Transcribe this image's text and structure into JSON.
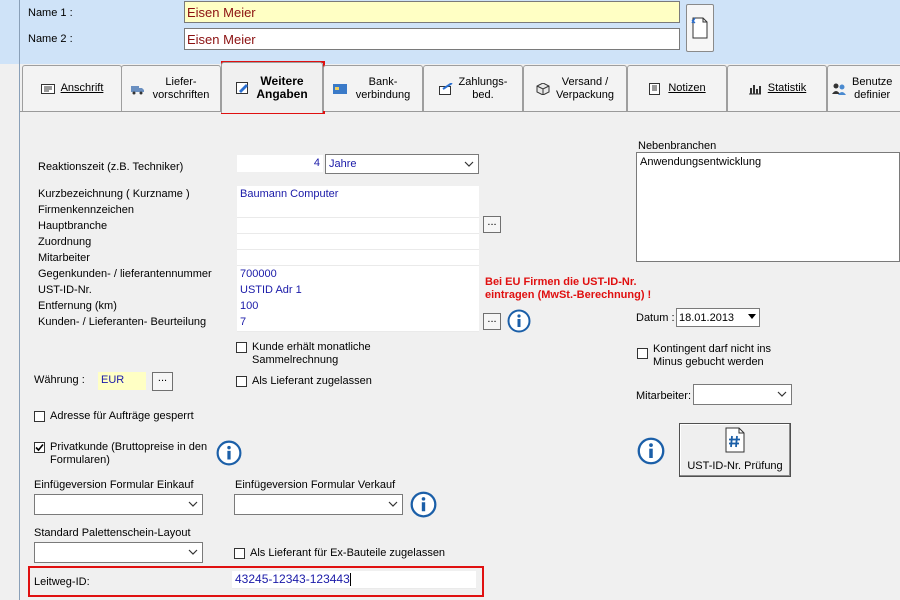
{
  "header": {
    "name1_label": "Name 1 :",
    "name1_value": "Eisen Meier",
    "name2_label": "Name 2 :",
    "name2_value": "Eisen Meier"
  },
  "tabs": [
    {
      "label": "Anschrift"
    },
    {
      "label": "Liefer-\nvorschriften"
    },
    {
      "label": "Weitere\nAngaben"
    },
    {
      "label": "Bank-\nverbindung"
    },
    {
      "label": "Zahlungs-\nbed."
    },
    {
      "label": "Versand /\nVerpackung"
    },
    {
      "label": "Notizen"
    },
    {
      "label": "Statistik"
    },
    {
      "label": "Benutze\ndefinier"
    }
  ],
  "left": {
    "reaktionszeit_label": "Reaktionszeit (z.B. Techniker)",
    "reaktionszeit_value": "4",
    "reaktionszeit_unit": "Jahre",
    "kurzbez_label": "Kurzbezeichnung ( Kurzname )",
    "kurzbez_value": "Baumann Computer",
    "firmenkenn_label": "Firmenkennzeichen",
    "hauptbranche_label": "Hauptbranche",
    "zuordnung_label": "Zuordnung",
    "mitarbeiter_label": "Mitarbeiter",
    "gegenkunden_label": "Gegenkunden- / lieferantennummer",
    "gegenkunden_value": "700000",
    "ustid_label": "UST-ID-Nr.",
    "ustid_value": "USTID Adr 1",
    "entfernung_label": "Entfernung (km)",
    "entfernung_value": "100",
    "beurteilung_label": "Kunden- / Lieferanten- Beurteilung",
    "beurteilung_value": "7",
    "ellipsis": "...",
    "warning_line1": "Bei EU Firmen die UST-ID-Nr.",
    "warning_line2": "eintragen (MwSt.-Berechnung) !",
    "sammelrechnung_label": "Kunde erhält monatliche\nSammelrechnung",
    "lieferant_label": "Als Lieferant zugelassen",
    "waehrung_label": "Währung :",
    "waehrung_value": "EUR",
    "adresse_gesperrt_label": "Adresse für Aufträge gesperrt",
    "privatkunde_label": "Privatkunde (Bruttopreise in den\nFormularen)",
    "einkauf_label": "Einfügeversion Formular Einkauf",
    "verkauf_label": "Einfügeversion Formular Verkauf",
    "paletten_label": "Standard Palettenschein-Layout",
    "exbauteile_label": "Als Lieferant für Ex-Bauteile zugelassen",
    "leitweg_label": "Leitweg-ID:",
    "leitweg_value": "43245-12343-123443"
  },
  "right": {
    "nebenbranchen_label": "Nebenbranchen",
    "nebenbranchen_value": "Anwendungsentwicklung",
    "datum_label": "Datum :",
    "datum_value": "18.01.2013",
    "kontingent_label": "Kontingent darf nicht ins\nMinus gebucht werden",
    "mitarbeiter_label": "Mitarbeiter:",
    "ustpruefung_label": "UST-ID-Nr. Prüfung"
  },
  "colors": {
    "warning": "#e01010",
    "field_text": "#1a1aa8",
    "name_text": "#8b1010",
    "header_bg": "#cfe3f8"
  }
}
